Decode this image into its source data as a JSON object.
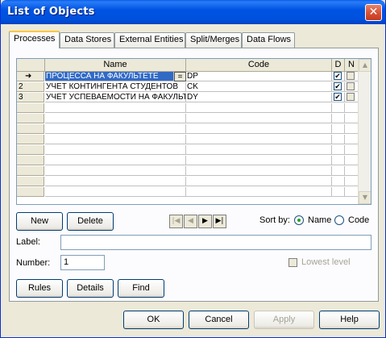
{
  "window": {
    "title": "List of Objects",
    "close_glyph": "✕"
  },
  "tabs": [
    {
      "label": "Processes",
      "active": true
    },
    {
      "label": "Data Stores"
    },
    {
      "label": "External Entities"
    },
    {
      "label": "Split/Merges"
    },
    {
      "label": "Data Flows"
    }
  ],
  "grid": {
    "headers": {
      "name": "Name",
      "code": "Code",
      "d": "D",
      "n": "N"
    },
    "rows": [
      {
        "row_label": "➜",
        "name": "ПРОЦЕССА НА ФАКУЛЬТЕТЕ",
        "code": "DP",
        "d": true,
        "n": false,
        "selected": true,
        "editor_glyph": "="
      },
      {
        "row_label": "2",
        "name": "УЧЕТ КОНТИНГЕНТА СТУДЕНТОВ",
        "code": "CK",
        "d": true,
        "n": false
      },
      {
        "row_label": "3",
        "name": "УЧЕТ УСПЕВАЕМОСТИ НА ФАКУЛЬТЕТЕ",
        "code": "DY",
        "d": true,
        "n": false
      }
    ],
    "empty_rows": 9,
    "scroll": {
      "up": "▲",
      "down": "▼"
    }
  },
  "buttons": {
    "new": "New",
    "delete": "Delete",
    "rules": "Rules",
    "details": "Details",
    "find": "Find",
    "ok": "OK",
    "cancel": "Cancel",
    "apply": "Apply",
    "help": "Help"
  },
  "nav": {
    "first": "|◀",
    "prev": "◀",
    "next": "▶",
    "last": "▶|"
  },
  "sort": {
    "label": "Sort by:",
    "options": [
      {
        "label": "Name",
        "selected": true
      },
      {
        "label": "Code",
        "selected": false
      }
    ]
  },
  "fields": {
    "label_caption": "Label:",
    "label_value": "",
    "number_caption": "Number:",
    "number_value": "1",
    "lowest_level_label": "Lowest level"
  }
}
